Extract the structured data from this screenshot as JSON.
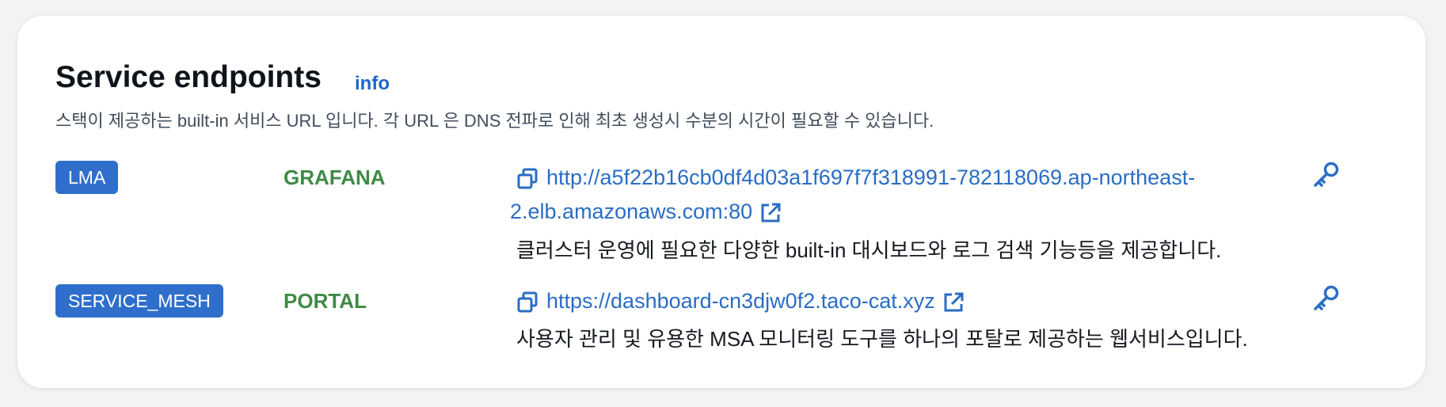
{
  "section": {
    "title": "Service endpoints",
    "info_label": "info",
    "description": "스택이 제공하는 built-in 서비스 URL 입니다. 각 URL 은 DNS 전파로 인해 최초 생성시 수분의 시간이 필요할 수 있습니다."
  },
  "endpoints": [
    {
      "group": "LMA",
      "name": "GRAFANA",
      "url_line1": "http://a5f22b16cb0df4d03a1f697f7f318991-782118069.ap-northeast-",
      "url_line2": "2.elb.amazonaws.com:80",
      "description": "클러스터 운영에 필요한 다양한 built-in 대시보드와 로그 검색 기능등을 제공합니다."
    },
    {
      "group": "SERVICE_MESH",
      "name": "PORTAL",
      "url_line1": "https://dashboard-cn3djw0f2.taco-cat.xyz",
      "description": "사용자 관리 및 유용한 MSA 모니터링 도구를 하나의 포탈로 제공하는 웹서비스입니다."
    }
  ],
  "icons": {
    "copy": "copy-icon",
    "external": "external-link-icon",
    "key": "key-icon"
  },
  "colors": {
    "badge": "#2f6fcb",
    "service_name": "#3f8a45",
    "link": "#2a6dc4"
  }
}
